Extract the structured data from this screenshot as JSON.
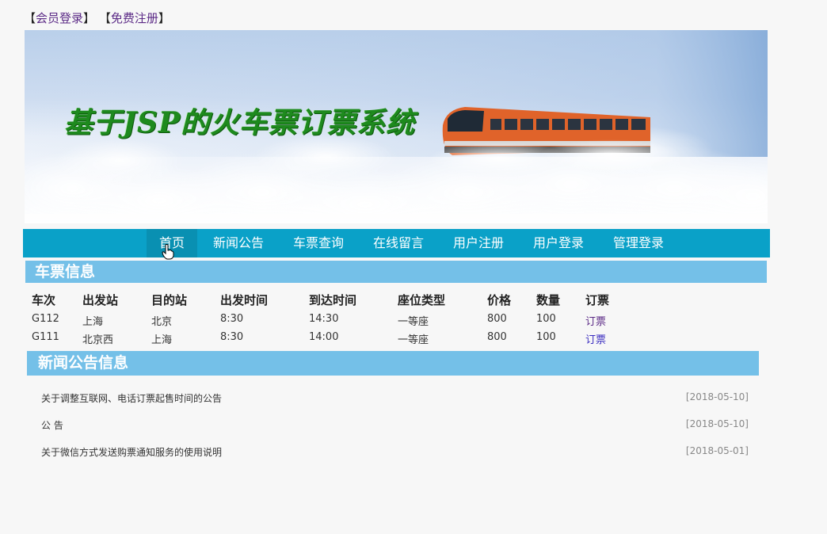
{
  "header": {
    "bracket_open": "【",
    "bracket_close": "】",
    "login_link": "会员登录",
    "register_link": "免费注册"
  },
  "banner": {
    "title": "基于JSP的火车票订票系统"
  },
  "nav": {
    "items": [
      "首页",
      "新闻公告",
      "车票查询",
      "在线留言",
      "用户注册",
      "用户登录",
      "管理登录"
    ],
    "active_index": 0
  },
  "tickets": {
    "section_title": "车票信息",
    "columns": [
      "车次",
      "出发站",
      "目的站",
      "出发时间",
      "到达时间",
      "座位类型",
      "价格",
      "数量",
      "订票"
    ],
    "rows": [
      {
        "train": "G112",
        "from": "上海",
        "to": "北京",
        "depart": "8:30",
        "arrive": "14:30",
        "seat": "一等座",
        "price": "800",
        "qty": "100",
        "action": "订票"
      },
      {
        "train": "G111",
        "from": "北京西",
        "to": "上海",
        "depart": "8:30",
        "arrive": "14:00",
        "seat": "一等座",
        "price": "800",
        "qty": "100",
        "action": "订票"
      }
    ]
  },
  "news": {
    "section_title": "新闻公告信息",
    "items": [
      {
        "title": "关于调整互联网、电话订票起售时间的公告",
        "date": "[2018-05-10]"
      },
      {
        "title": "公 告",
        "date": "[2018-05-10]"
      },
      {
        "title": "关于微信方式发送购票通知服务的使用说明",
        "date": "[2018-05-01]"
      }
    ]
  },
  "colors": {
    "nav_bg": "#0aa1c8",
    "section_bg": "#74c0e8",
    "link_visited": "#5b2a86",
    "link": "#3a2cc0",
    "banner_title": "#1e8a1e"
  }
}
